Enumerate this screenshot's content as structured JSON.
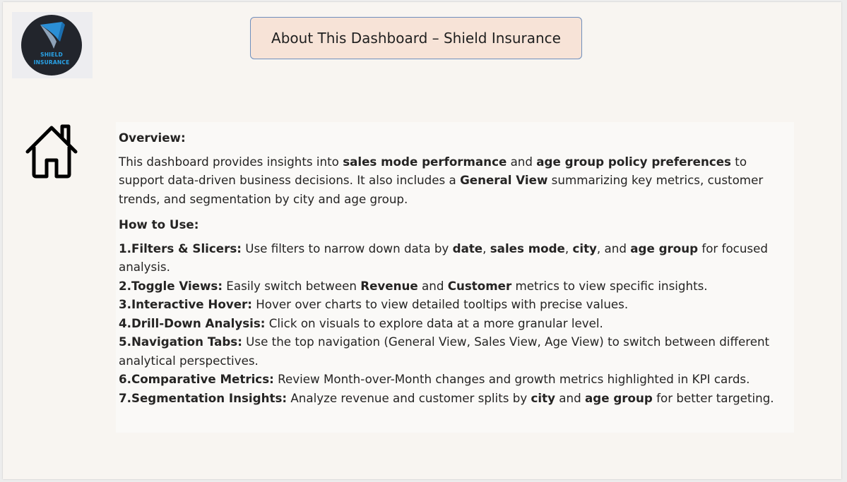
{
  "logo": {
    "line1": "SHIELD",
    "line2": "INSURANCE"
  },
  "title": "About This Dashboard – Shield Insurance",
  "icons": {
    "home": "home-icon"
  },
  "colors": {
    "canvas_bg": "#f8f5f1",
    "title_bg": "#f7e3d7",
    "title_border": "#6f8fbd",
    "logo_blue": "#29a3e8"
  },
  "overview": {
    "heading": "Overview:",
    "t1": "This dashboard provides insights into ",
    "b1": "sales mode performance",
    "t2": " and ",
    "b2": "age group policy preferences",
    "t3": " to support data-driven business decisions. It also includes a ",
    "b3": "General View",
    "t4": " summarizing key metrics, customer trends, and segmentation by city and age group."
  },
  "how_to_use": {
    "heading": "How to Use:",
    "item1": {
      "label": "1.Filters & Slicers:",
      "t1": " Use filters to narrow down data by ",
      "b1": "date",
      "s1": ", ",
      "b2": "sales mode",
      "s2": ", ",
      "b3": "city",
      "s3": ", and ",
      "b4": "age group",
      "t2": " for focused analysis."
    },
    "item2": {
      "label": "2.Toggle Views:",
      "t1": " Easily switch between ",
      "b1": "Revenue",
      "t2": " and ",
      "b2": "Customer",
      "t3": " metrics to view specific insights."
    },
    "item3": {
      "label": "3.Interactive Hover:",
      "t1": " Hover over charts to view detailed tooltips with precise values."
    },
    "item4": {
      "label": "4.Drill-Down Analysis:",
      "t1": " Click on visuals to explore data at a more granular level."
    },
    "item5": {
      "label": "5.Navigation Tabs:",
      "t1": " Use the top navigation (General View, Sales View, Age View) to switch between different analytical perspectives."
    },
    "item6": {
      "label": "6.Comparative Metrics:",
      "t1": " Review Month-over-Month changes and growth metrics highlighted in KPI cards."
    },
    "item7": {
      "label": "7.Segmentation Insights:",
      "t1": " Analyze revenue and customer splits by ",
      "b1": "city",
      "t2": " and ",
      "b2": "age group",
      "t3": " for better targeting."
    }
  }
}
